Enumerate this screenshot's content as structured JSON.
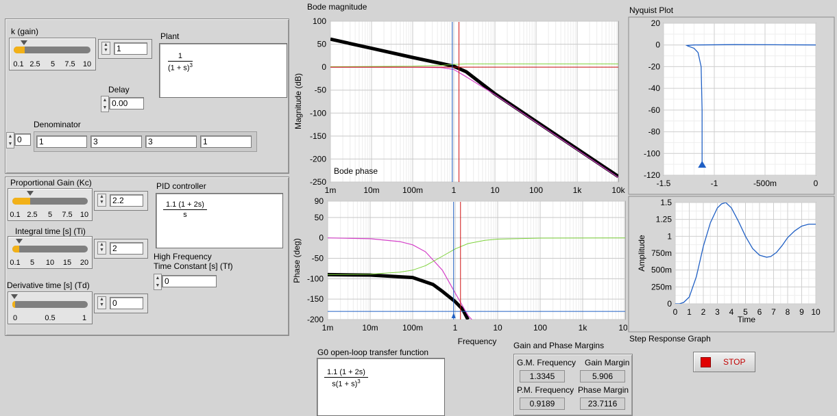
{
  "plant": {
    "k_label": "k (gain)",
    "k_ticks": [
      "0.1",
      "2.5",
      "5",
      "7.5",
      "10"
    ],
    "k_value": "1",
    "plant_label": "Plant",
    "plant_num": "1",
    "plant_den": "(1 + s)",
    "plant_den_exp": "3",
    "delay_label": "Delay",
    "delay_value": "0.00",
    "denominator_label": "Denominator",
    "den_index": "0",
    "den_values": [
      "1",
      "3",
      "3",
      "1"
    ]
  },
  "pid": {
    "kc_label": "Proportional Gain (Kc)",
    "kc_ticks": [
      "0.1",
      "2.5",
      "5",
      "7.5",
      "10"
    ],
    "kc_value": "2.2",
    "ti_label": "Integral time [s] (Ti)",
    "ti_ticks": [
      "0.1",
      "5",
      "10",
      "15",
      "20"
    ],
    "ti_value": "2",
    "td_label": "Derivative time [s] (Td)",
    "td_ticks": [
      "0",
      "0.5",
      "1"
    ],
    "td_value": "0",
    "pid_label": "PID controller",
    "pid_num": "1.1 (1 + 2s)",
    "pid_den": "s",
    "tf_label_1": "High Frequency",
    "tf_label_2": "Time Constant [s] (Tf)",
    "tf_value": "0"
  },
  "g0": {
    "label": "G0 open-loop transfer function",
    "num": "1.1 (1 + 2s)",
    "den": "s(1 + s)",
    "den_exp": "3"
  },
  "margins": {
    "title": "Gain and Phase Margins",
    "gm_freq_label": "G.M. Frequency",
    "gm_freq_value": "1.3345",
    "gain_margin_label": "Gain Margin",
    "gain_margin_value": "5.906",
    "pm_freq_label": "P.M. Frequency",
    "pm_freq_value": "0.9189",
    "phase_margin_label": "Phase Margin",
    "phase_margin_value": "23.7116"
  },
  "stop_label": "STOP",
  "colors": {
    "slider_fill": "#f2b118",
    "stop_red": "#e00000",
    "g0_curve": "#000000",
    "plant_curve": "#d43fc8",
    "controller_curve": "#7dd23a",
    "marker_blue": "#1f5fc4",
    "marker_red": "#d01010"
  },
  "chart_data": [
    {
      "type": "line",
      "title": "Bode magnitude",
      "xlabel": "",
      "ylabel": "Magnitude (dB)",
      "xscale": "log",
      "xlim": [
        0.001,
        10000
      ],
      "ylim": [
        -250,
        100
      ],
      "xticks": [
        "1m",
        "10m",
        "100m",
        "1",
        "10",
        "100",
        "1k",
        "10k"
      ],
      "yticks": [
        "100",
        "50",
        "0",
        "-50",
        "-100",
        "-150",
        "-200",
        "-250"
      ],
      "series": [
        {
          "values_x": [
            0.001,
            0.01,
            0.1,
            0.5,
            1,
            2,
            10,
            100,
            1000,
            10000
          ],
          "values_y": [
            61,
            41,
            21,
            8,
            2,
            -10,
            -58,
            -118,
            -178,
            -238
          ]
        },
        {
          "values_x": [
            0.001,
            0.1,
            0.5,
            1,
            2,
            10,
            100,
            1000,
            10000
          ],
          "values_y": [
            0,
            0,
            -1,
            -5,
            -21,
            -60,
            -120,
            -180,
            -240
          ]
        },
        {
          "values_x": [
            0.001,
            0.1,
            0.5,
            1,
            2,
            10,
            10000
          ],
          "values_y": [
            1,
            2,
            4,
            6,
            7,
            7,
            7
          ]
        },
        {
          "values_x": [
            0.001,
            10000
          ],
          "values_y": [
            0,
            0
          ]
        }
      ],
      "markers": {
        "blue_x": 0.9189,
        "red_x": 1.3345
      }
    },
    {
      "type": "line",
      "title": "Bode phase",
      "xlabel": "Frequency",
      "ylabel": "Phase (deg)",
      "xscale": "log",
      "xlim": [
        0.001,
        10000
      ],
      "ylim": [
        -200,
        90
      ],
      "xticks": [
        "1m",
        "10m",
        "100m",
        "1",
        "10",
        "100",
        "1k",
        "10k"
      ],
      "yticks": [
        "90",
        "50",
        "0",
        "-50",
        "-100",
        "-150",
        "-200"
      ],
      "series": [
        {
          "values_x": [
            0.001,
            0.01,
            0.1,
            0.3,
            0.5,
            1,
            1.5,
            2
          ],
          "values_y": [
            -90,
            -91,
            -97,
            -114,
            -131,
            -156,
            -175,
            -200
          ]
        },
        {
          "values_x": [
            0.001,
            0.01,
            0.05,
            0.1,
            0.2,
            0.5,
            1,
            2,
            5,
            10,
            100
          ],
          "values_y": [
            0,
            -2,
            -9,
            -17,
            -34,
            -79,
            -135,
            -190,
            -235,
            -255,
            -268
          ]
        },
        {
          "values_x": [
            0.001,
            0.01,
            0.05,
            0.1,
            0.2,
            0.5,
            1,
            2,
            5,
            10,
            100,
            10000
          ],
          "values_y": [
            -90,
            -89,
            -84,
            -79,
            -68,
            -45,
            -27,
            -14,
            -6,
            -3,
            -0.5,
            0
          ]
        },
        {
          "values_x": [
            0.001,
            10000
          ],
          "values_y": [
            -180,
            -180
          ]
        }
      ],
      "markers": {
        "blue_x": 0.9189,
        "red_x": 1.3345
      }
    },
    {
      "type": "line",
      "title": "Nyquist Plot",
      "xlabel": "",
      "ylabel": "",
      "xlim": [
        -1.5,
        0
      ],
      "ylim": [
        -120,
        20
      ],
      "xticks": [
        "-1.5",
        "-1",
        "-500m",
        "0"
      ],
      "yticks": [
        "20",
        "0",
        "-20",
        "-40",
        "-60",
        "-80",
        "-100",
        "-120"
      ],
      "series": [
        {
          "x": [
            -1.12,
            -1.12,
            -1.13,
            -1.16,
            -1.2,
            -1.26,
            -1.27,
            -1.2,
            -0.8,
            -0.4,
            0
          ],
          "y": [
            -110,
            -60,
            -20,
            -7,
            -3,
            -1,
            -0.5,
            0,
            0.3,
            0.2,
            0
          ]
        }
      ],
      "marker": {
        "x": -1.12,
        "y": -110
      }
    },
    {
      "type": "line",
      "title": "Step Response Graph",
      "xlabel": "Time",
      "ylabel": "Amplitude",
      "xlim": [
        0,
        10
      ],
      "ylim": [
        0,
        1.5
      ],
      "xticks": [
        "0",
        "1",
        "2",
        "3",
        "4",
        "5",
        "6",
        "7",
        "8",
        "9",
        "10"
      ],
      "yticks": [
        "1.5",
        "1.25",
        "1",
        "750m",
        "500m",
        "250m",
        "0"
      ],
      "series": [
        {
          "x": [
            0,
            0.3,
            0.6,
            1,
            1.5,
            2,
            2.5,
            3,
            3.3,
            3.6,
            4,
            4.5,
            5,
            5.5,
            6,
            6.5,
            6.8,
            7.2,
            7.6,
            8,
            8.5,
            9,
            9.5,
            10
          ],
          "y": [
            0,
            0,
            0.02,
            0.1,
            0.4,
            0.85,
            1.2,
            1.42,
            1.48,
            1.5,
            1.42,
            1.22,
            1.0,
            0.82,
            0.72,
            0.69,
            0.7,
            0.76,
            0.86,
            0.98,
            1.08,
            1.15,
            1.18,
            1.18
          ]
        }
      ]
    }
  ]
}
